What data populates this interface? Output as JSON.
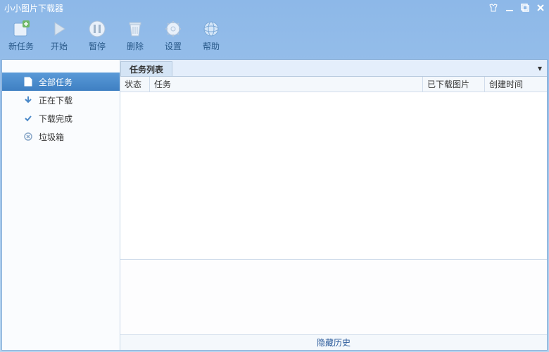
{
  "window": {
    "title": "小小图片下载器"
  },
  "toolbar": {
    "new_task": "新任务",
    "start": "开始",
    "pause": "暂停",
    "delete": "删除",
    "settings": "设置",
    "help": "帮助"
  },
  "sidebar": {
    "items": [
      {
        "label": "全部任务"
      },
      {
        "label": "正在下载"
      },
      {
        "label": "下载完成"
      },
      {
        "label": "垃圾箱"
      }
    ]
  },
  "main": {
    "tab_label": "任务列表",
    "columns": [
      "状态",
      "任务",
      "已下载图片",
      "创建时间"
    ],
    "hide_history": "隐藏历史"
  }
}
